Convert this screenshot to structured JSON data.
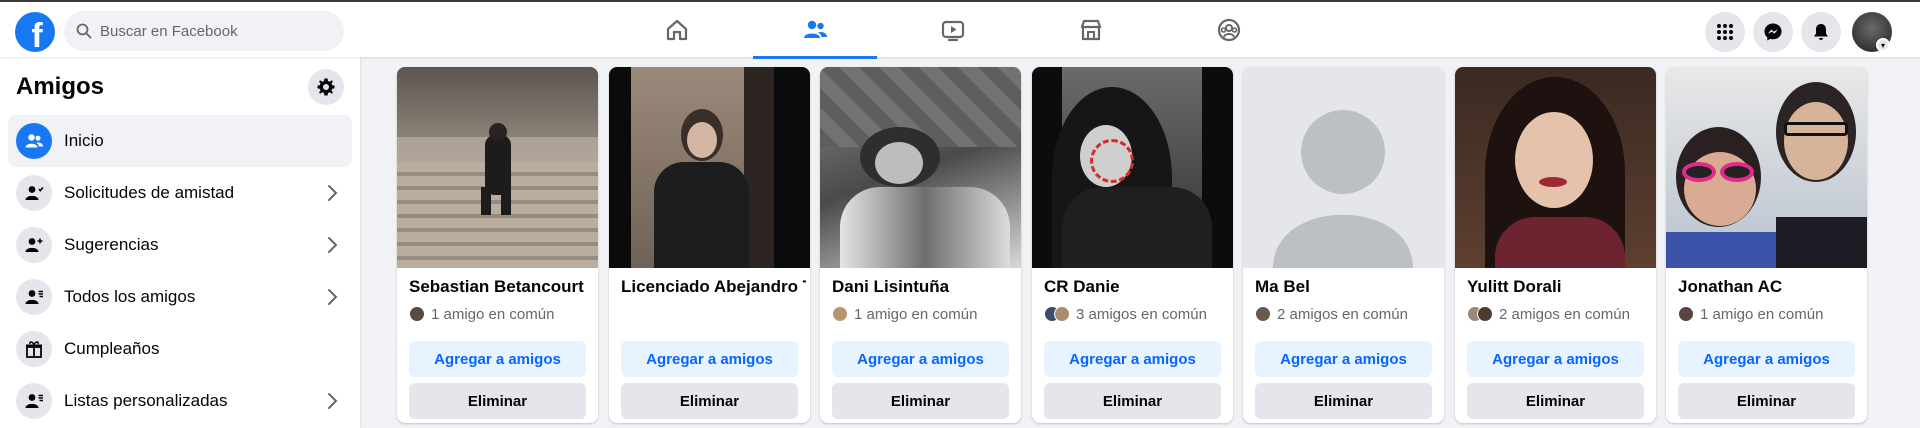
{
  "header": {
    "logo_letter": "f",
    "search_placeholder": "Buscar en Facebook"
  },
  "sidebar": {
    "title": "Amigos",
    "items": [
      {
        "label": "Inicio"
      },
      {
        "label": "Solicitudes de amistad"
      },
      {
        "label": "Sugerencias"
      },
      {
        "label": "Todos los amigos"
      },
      {
        "label": "Cumpleaños"
      },
      {
        "label": "Listas personalizadas"
      }
    ]
  },
  "cards": [
    {
      "name": "Sebastian Betancourt",
      "mutual": "1 amigo en común",
      "add": "Agregar a amigos",
      "remove": "Eliminar"
    },
    {
      "name": "Licenciado Abejandro T",
      "mutual": "",
      "add": "Agregar a amigos",
      "remove": "Eliminar"
    },
    {
      "name": "Dani Lisintuña",
      "mutual": "1 amigo en común",
      "add": "Agregar a amigos",
      "remove": "Eliminar"
    },
    {
      "name": "CR Danie",
      "mutual": "3 amigos en común",
      "add": "Agregar a amigos",
      "remove": "Eliminar"
    },
    {
      "name": "Ma Bel",
      "mutual": "2 amigos en común",
      "add": "Agregar a amigos",
      "remove": "Eliminar"
    },
    {
      "name": "Yulitt Dorali",
      "mutual": "2 amigos en común",
      "add": "Agregar a amigos",
      "remove": "Eliminar"
    },
    {
      "name": "Jonathan AC",
      "mutual": "1 amigo en común",
      "add": "Agregar a amigos",
      "remove": "Eliminar"
    }
  ],
  "colors": {
    "brand": "#1877f2",
    "add_button_bg": "#e7f3ff",
    "add_button_text": "#0866ff",
    "secondary_button_bg": "#e4e6eb"
  }
}
